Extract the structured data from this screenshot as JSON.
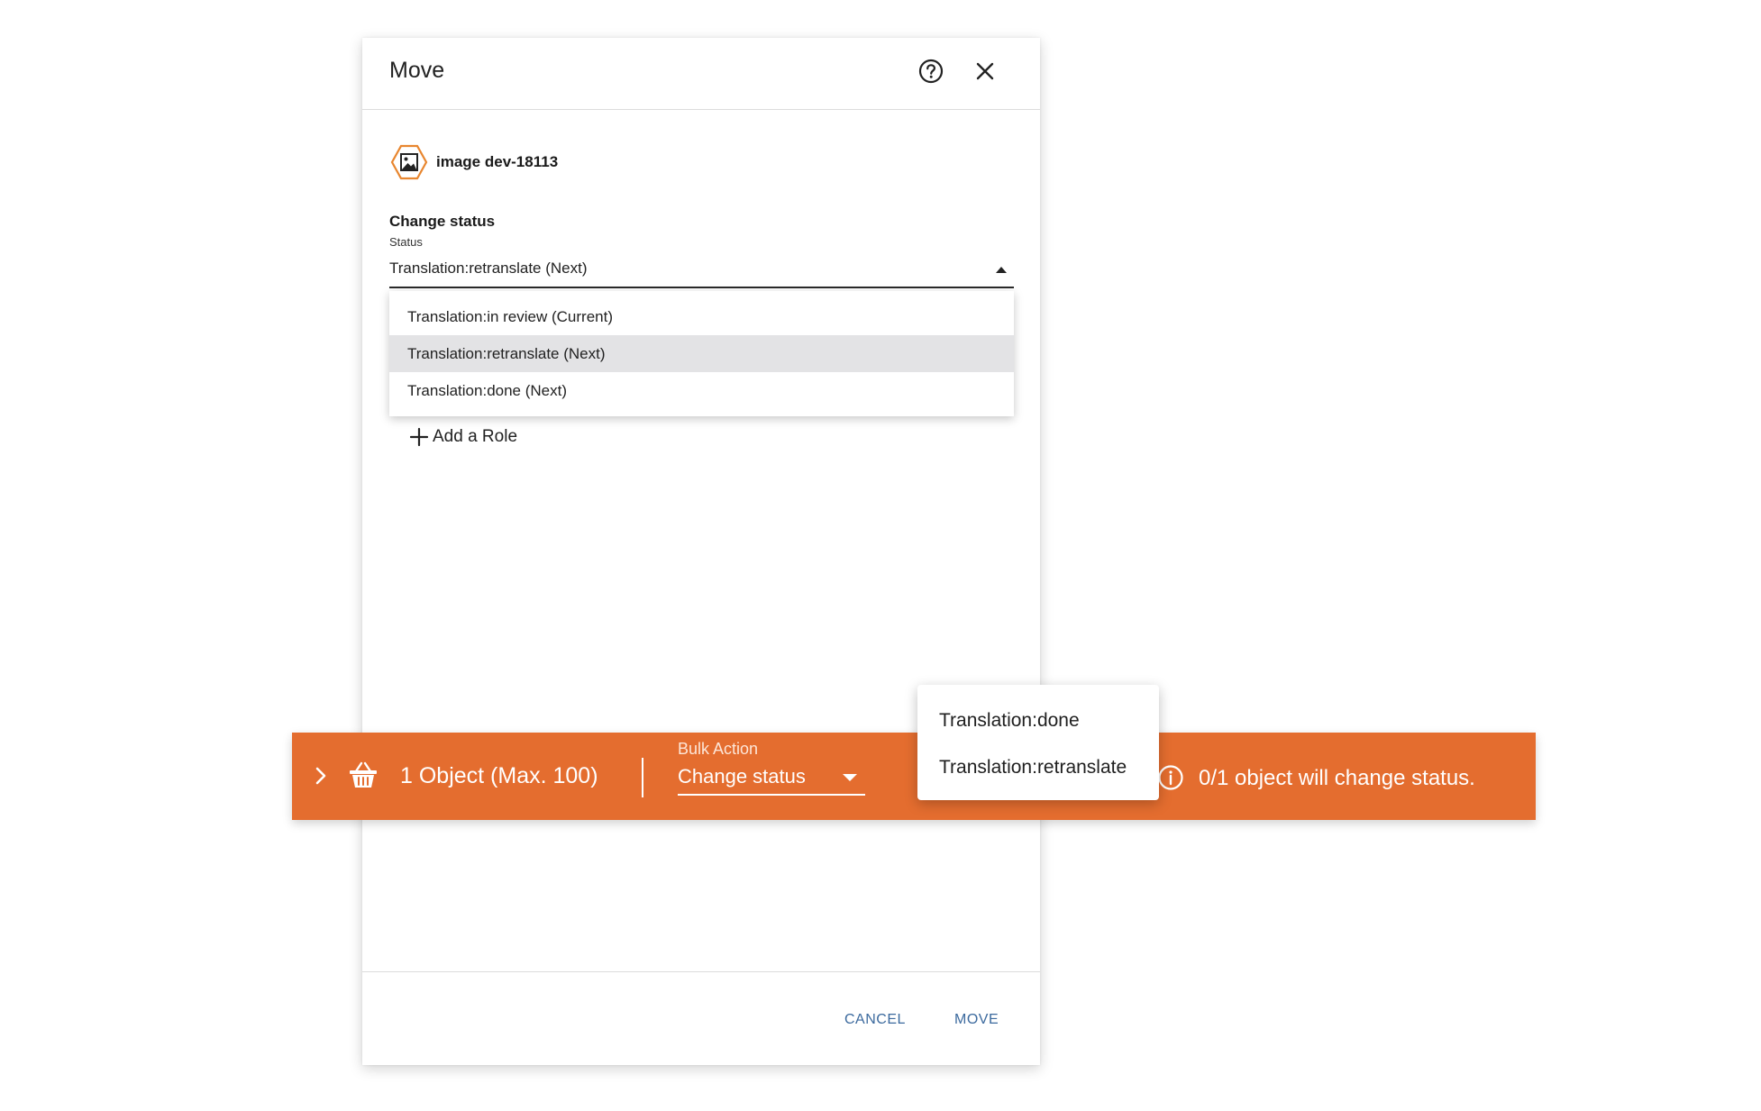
{
  "dialog": {
    "title": "Move",
    "object_name": "image dev-18113",
    "section_title": "Change status",
    "status_label": "Status",
    "status_value": "Translation:retranslate (Next)",
    "status_options": [
      "Translation:in review (Current)",
      "Translation:retranslate (Next)",
      "Translation:done (Next)"
    ],
    "selected_option_index": 1,
    "add_role_label": "Add a Role",
    "cancel_label": "CANCEL",
    "move_label": "MOVE"
  },
  "bulk_bar": {
    "object_count": "1 Object (Max. 100)",
    "bulk_action_label": "Bulk Action",
    "bulk_action_value": "Change status",
    "status_message": "0/1 object will change status.",
    "background_color": "#e46d2f"
  },
  "status_popup": {
    "options": [
      "Translation:done",
      "Translation:retranslate"
    ]
  },
  "icons": {
    "help": "help-circle-icon",
    "close": "close-icon",
    "object": "image-hexagon-icon",
    "add": "plus-icon",
    "expand": "chevron-right-icon",
    "basket": "basket-icon",
    "info": "info-circle-icon"
  },
  "colors": {
    "accent_orange": "#e46d2f",
    "link_blue": "#3c6a9e",
    "hexagon_orange": "#e8862f",
    "selected_row": "#e3e3e5"
  }
}
